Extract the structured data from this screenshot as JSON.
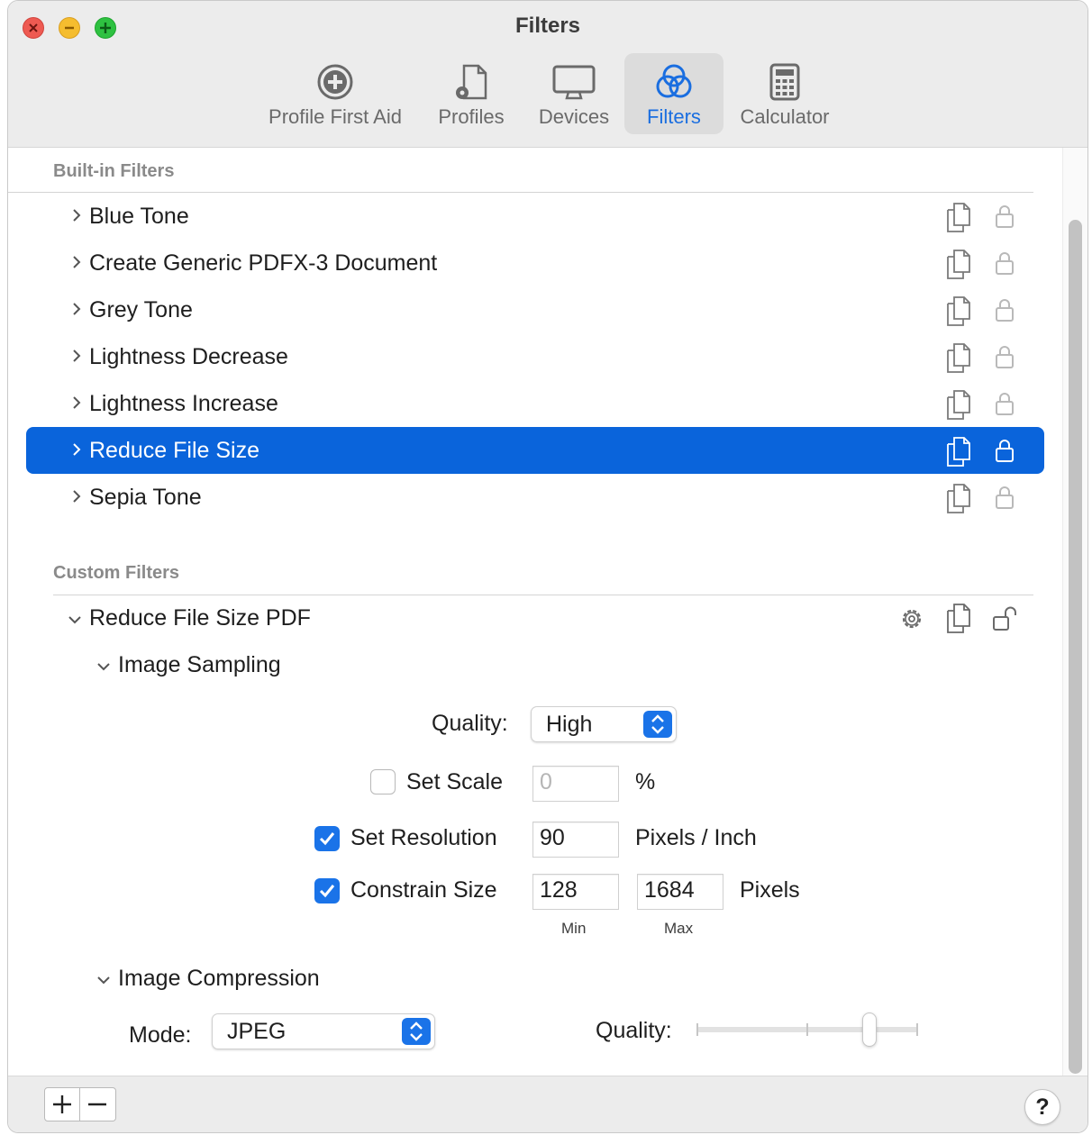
{
  "window": {
    "title": "Filters"
  },
  "toolbar": [
    {
      "label": "Profile First Aid",
      "icon": "plus-circle-icon"
    },
    {
      "label": "Profiles",
      "icon": "document-gear-icon"
    },
    {
      "label": "Devices",
      "icon": "display-icon"
    },
    {
      "label": "Filters",
      "icon": "venn-circles-icon",
      "active": true
    },
    {
      "label": "Calculator",
      "icon": "calculator-icon"
    }
  ],
  "builtin": {
    "header": "Built-in Filters",
    "items": [
      {
        "label": "Blue Tone"
      },
      {
        "label": "Create Generic PDFX-3 Document"
      },
      {
        "label": "Grey Tone"
      },
      {
        "label": "Lightness Decrease"
      },
      {
        "label": "Lightness Increase"
      },
      {
        "label": "Reduce File Size",
        "selected": true
      },
      {
        "label": "Sepia Tone"
      }
    ]
  },
  "custom": {
    "header": "Custom Filters",
    "filter_name": "Reduce File Size PDF",
    "image_sampling": {
      "title": "Image Sampling",
      "quality_label": "Quality:",
      "quality_value": "High",
      "set_scale_label": "Set Scale",
      "set_scale_checked": false,
      "scale_value": "0",
      "scale_unit": "%",
      "set_resolution_label": "Set Resolution",
      "set_resolution_checked": true,
      "resolution_value": "90",
      "resolution_unit": "Pixels / Inch",
      "constrain_label": "Constrain Size",
      "constrain_checked": true,
      "min_value": "128",
      "max_value": "1684",
      "size_unit": "Pixels",
      "min_caption": "Min",
      "max_caption": "Max"
    },
    "image_compression": {
      "title": "Image Compression",
      "mode_label": "Mode:",
      "mode_value": "JPEG",
      "quality_label": "Quality:",
      "quality_level": 0.78
    }
  },
  "bottom": {
    "add": "+",
    "remove": "−",
    "help": "?"
  },
  "colors": {
    "accent": "#0a64db",
    "close": "#ee5a52",
    "minimize": "#f5bd2f",
    "zoom": "#2ec141"
  }
}
